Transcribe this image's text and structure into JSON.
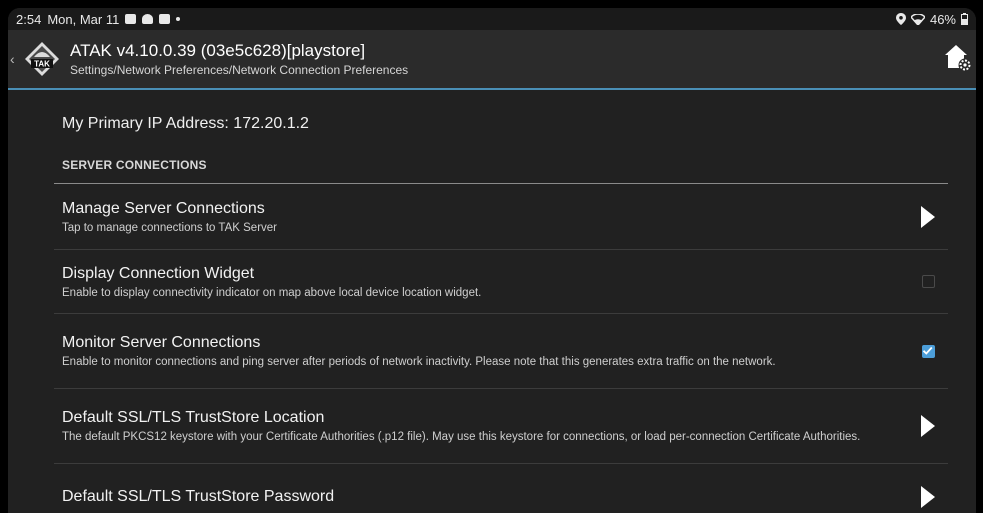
{
  "status_bar": {
    "time": "2:54",
    "date": "Mon, Mar 11",
    "battery": "46%",
    "icons": [
      "location-icon",
      "wifi-icon",
      "battery-icon"
    ]
  },
  "toolbar": {
    "app_title": "ATAK v4.10.0.39 (03e5c628)[playstore]",
    "breadcrumb": "Settings/Network Preferences/Network Connection Preferences",
    "logo_text": "TAK",
    "accent_color": "#4a8fb6"
  },
  "ip": {
    "text": "My Primary IP Address: 172.20.1.2"
  },
  "category": {
    "label": "SERVER CONNECTIONS"
  },
  "prefs": [
    {
      "title": "Manage Server Connections",
      "summary": "Tap to manage connections to TAK Server",
      "widget": "arrow"
    },
    {
      "title": "Display Connection Widget",
      "summary": "Enable to display connectivity indicator on map above local device location widget.",
      "widget": "checkbox",
      "checked": false
    },
    {
      "title": "Monitor Server Connections",
      "summary": "Enable to monitor connections and ping server after periods of network inactivity. Please note that this generates extra traffic on the network.",
      "widget": "checkbox",
      "checked": true
    },
    {
      "title": "Default SSL/TLS TrustStore Location",
      "summary": "The default PKCS12 keystore with your Certificate Authorities (.p12 file). May use this keystore for connections, or load per-connection Certificate Authorities.",
      "widget": "arrow"
    },
    {
      "title": "Default SSL/TLS TrustStore Password",
      "summary": "",
      "widget": "arrow"
    }
  ]
}
